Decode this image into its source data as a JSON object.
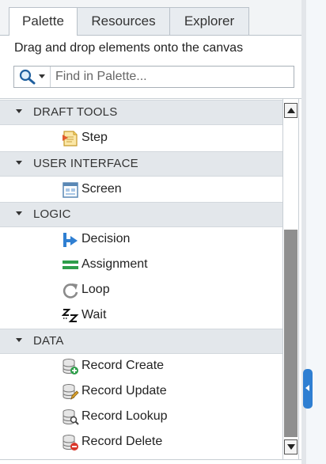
{
  "tabs": [
    {
      "label": "Palette",
      "active": true
    },
    {
      "label": "Resources",
      "active": false
    },
    {
      "label": "Explorer",
      "active": false
    }
  ],
  "hint": "Drag and drop elements onto the canvas",
  "search": {
    "placeholder": "Find in Palette...",
    "value": "",
    "icon": "search-icon"
  },
  "sections": [
    {
      "title": "DRAFT TOOLS",
      "items": [
        {
          "label": "Step",
          "icon": "step-icon"
        }
      ]
    },
    {
      "title": "USER INTERFACE",
      "items": [
        {
          "label": "Screen",
          "icon": "screen-icon"
        }
      ]
    },
    {
      "title": "LOGIC",
      "items": [
        {
          "label": "Decision",
          "icon": "decision-icon"
        },
        {
          "label": "Assignment",
          "icon": "assignment-icon"
        },
        {
          "label": "Loop",
          "icon": "loop-icon"
        },
        {
          "label": "Wait",
          "icon": "wait-icon"
        }
      ]
    },
    {
      "title": "DATA",
      "items": [
        {
          "label": "Record Create",
          "icon": "record-create-icon"
        },
        {
          "label": "Record Update",
          "icon": "record-update-icon"
        },
        {
          "label": "Record Lookup",
          "icon": "record-lookup-icon"
        },
        {
          "label": "Record Delete",
          "icon": "record-delete-icon"
        }
      ]
    }
  ],
  "colors": {
    "accent": "#2f7fd2",
    "section_bg": "#e3e7eb",
    "scroll_thumb": "#8f8f8f"
  }
}
